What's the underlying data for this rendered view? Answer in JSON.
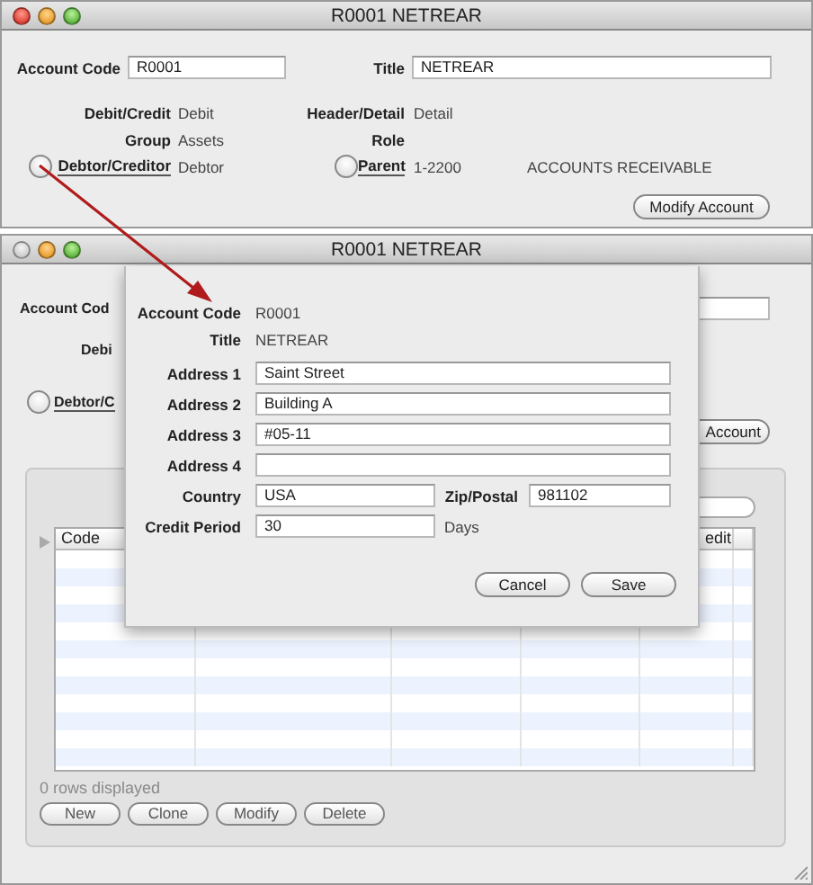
{
  "top_window": {
    "title": "R0001 NETREAR",
    "close_disabled": false,
    "account_code": {
      "label": "Account Code",
      "value": "R0001"
    },
    "title_field": {
      "label": "Title",
      "value": "NETREAR"
    },
    "info_rows": [
      {
        "left": {
          "label": "Debit/Credit",
          "value": "Debit"
        },
        "right": {
          "label": "Header/Detail",
          "value": "Detail"
        }
      },
      {
        "left": {
          "label": "Group",
          "value": "Assets"
        },
        "right": {
          "label": "Role"
        }
      }
    ],
    "lookups": {
      "left": {
        "label": "Debtor/Creditor",
        "value": "Debtor"
      },
      "right": {
        "label": "Parent",
        "value": "1-2200",
        "description": "ACCOUNTS RECEIVABLE"
      }
    },
    "button": "Modify Account"
  },
  "bottom_window": {
    "title": "R0001 NETREAR",
    "close_disabled": true,
    "account_code_label": "Account Cod",
    "debit_label": "Debi",
    "lookup_label": "Debtor/C",
    "button": "Account",
    "table": {
      "column_1": "Code",
      "column_5": "edit"
    },
    "status": "0 rows displayed",
    "buttons": [
      "New",
      "Clone",
      "Modify",
      "Delete"
    ]
  },
  "sheet": {
    "rows": [
      {
        "kind": "text",
        "label": "Account Code",
        "value": "R0001"
      },
      {
        "kind": "text",
        "label": "Title",
        "value": "NETREAR"
      },
      {
        "kind": "input",
        "label": "Address 1",
        "value": "Saint Street"
      },
      {
        "kind": "input",
        "label": "Address 2",
        "value": "Building A"
      },
      {
        "kind": "input",
        "label": "Address 3",
        "value": "#05-11"
      },
      {
        "kind": "input",
        "label": "Address 4"
      },
      {
        "kind": "pair",
        "label": "Country",
        "value": "USA",
        "label_2": "Zip/Postal",
        "value_2": "981102"
      },
      {
        "kind": "unit",
        "label": "Credit Period",
        "value": "30",
        "unit": "Days"
      }
    ],
    "buttons": [
      "Cancel",
      "Save"
    ]
  }
}
